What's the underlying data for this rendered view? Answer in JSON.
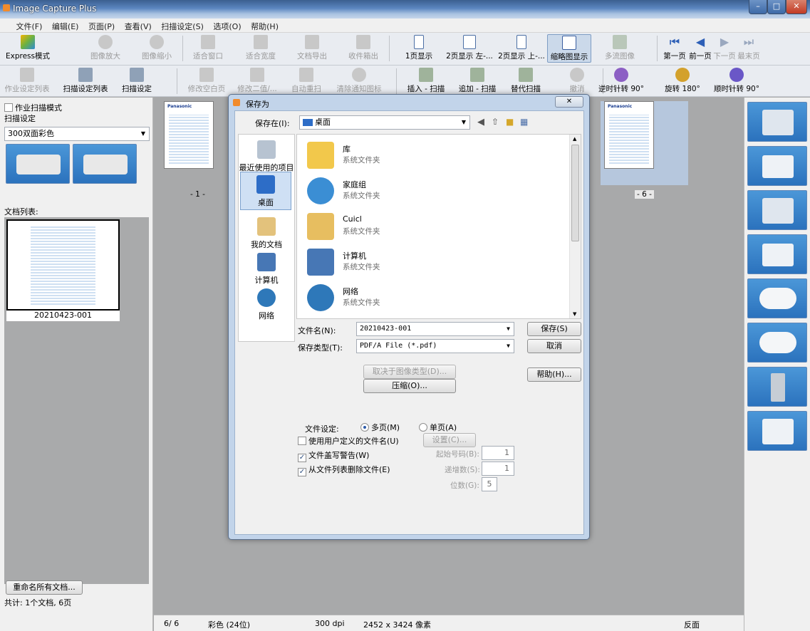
{
  "app": {
    "title": "Image Capture Plus"
  },
  "menu": [
    "文件(F)",
    "编辑(E)",
    "页面(P)",
    "查看(V)",
    "扫描设定(S)",
    "选项(O)",
    "帮助(H)"
  ],
  "toolbar1": [
    {
      "label": "Express模式",
      "enabled": true
    },
    {
      "label": "图像放大",
      "enabled": false
    },
    {
      "label": "图像缩小",
      "enabled": false
    },
    {
      "label": "适合窗口",
      "enabled": false
    },
    {
      "label": "适合宽度",
      "enabled": false
    },
    {
      "label": "文档导出",
      "enabled": false
    },
    {
      "label": "收件箱出",
      "enabled": false
    },
    {
      "label": "1页显示",
      "enabled": true
    },
    {
      "label": "2页显示 左-...",
      "enabled": true
    },
    {
      "label": "2页显示 上-...",
      "enabled": true
    },
    {
      "label": "缩略图显示",
      "enabled": true
    },
    {
      "label": "多流图像",
      "enabled": false
    },
    {
      "label": "第一页",
      "enabled": true
    },
    {
      "label": "前一页",
      "enabled": true
    },
    {
      "label": "下一页",
      "enabled": false
    },
    {
      "label": "最末页",
      "enabled": false
    }
  ],
  "toolbar2": [
    {
      "label": "作业设定列表",
      "enabled": false
    },
    {
      "label": "扫描设定列表",
      "enabled": true
    },
    {
      "label": "扫描设定",
      "enabled": true
    },
    {
      "label": "修改空白页",
      "enabled": false
    },
    {
      "label": "修改二值/...",
      "enabled": false
    },
    {
      "label": "自动重扫",
      "enabled": false
    },
    {
      "label": "清除通知图标",
      "enabled": false
    },
    {
      "label": "插入 - 扫描",
      "enabled": true
    },
    {
      "label": "追加 - 扫描",
      "enabled": true
    },
    {
      "label": "替代扫描",
      "enabled": true
    },
    {
      "label": "撤消",
      "enabled": false
    },
    {
      "label": "逆时针转 90°",
      "enabled": true
    },
    {
      "label": "旋转 180°",
      "enabled": true
    },
    {
      "label": "顺时针转 90°",
      "enabled": true
    }
  ],
  "left": {
    "job_mode": "作业扫描模式",
    "scan_setting_label": "扫描设定",
    "scan_setting_value": "300双面彩色",
    "doc_list_label": "文档列表:",
    "doc_name": "20210423-001",
    "rename_button": "重命名所有文档...",
    "summary": "共计:  1个文档,   6页"
  },
  "center": {
    "page1_label": "- 1 -",
    "page6_label": "- 6 -"
  },
  "thumb": {
    "brand": "Panasonic"
  },
  "right_icons": [
    "scan-to-server-icon",
    "email-icon",
    "scan-to-folder-icon",
    "print-icon",
    "cloud-icon",
    "online-icon",
    "server-icon",
    "edit-icon"
  ],
  "status": {
    "page": "6/  6",
    "color": "彩色 (24位)",
    "dpi": "300 dpi",
    "size": "2452 x 3424 像素",
    "side": "反面"
  },
  "dialog": {
    "title": "保存为",
    "save_in_label": "保存在(I):",
    "save_in_value": "桌面",
    "places": [
      "最近使用的项目",
      "桌面",
      "我的文档",
      "计算机",
      "网络"
    ],
    "files": [
      {
        "name": "库",
        "type": "系统文件夹"
      },
      {
        "name": "家庭组",
        "type": "系统文件夹"
      },
      {
        "name": "Cuicl",
        "type": "系统文件夹"
      },
      {
        "name": "计算机",
        "type": "系统文件夹"
      },
      {
        "name": "网络",
        "type": "系统文件夹"
      }
    ],
    "filename_label": "文件名(N):",
    "filename_value": "20210423-001",
    "filetype_label": "保存类型(T):",
    "filetype_value": "PDF/A File (*.pdf)",
    "save_button": "保存(S)",
    "cancel_button": "取消",
    "imagetype_button": "取决于图像类型(D)...",
    "compress_button": "压缩(O)...",
    "help_button": "帮助(H)...",
    "file_setting_label": "文件设定:",
    "multi_page": "多页(M)",
    "single_page": "单页(A)",
    "custom_name": "使用用户定义的文件名(U)",
    "settings_button": "设置(C)...",
    "overwrite_warning": "文件盖写警告(W)",
    "delete_from_list": "从文件列表删除文件(E)",
    "start_number_label": "起始号码(B):",
    "start_number": "1",
    "increment_label": "递增数(S):",
    "increment": "1",
    "digits_label": "位数(G):",
    "digits": "5"
  }
}
